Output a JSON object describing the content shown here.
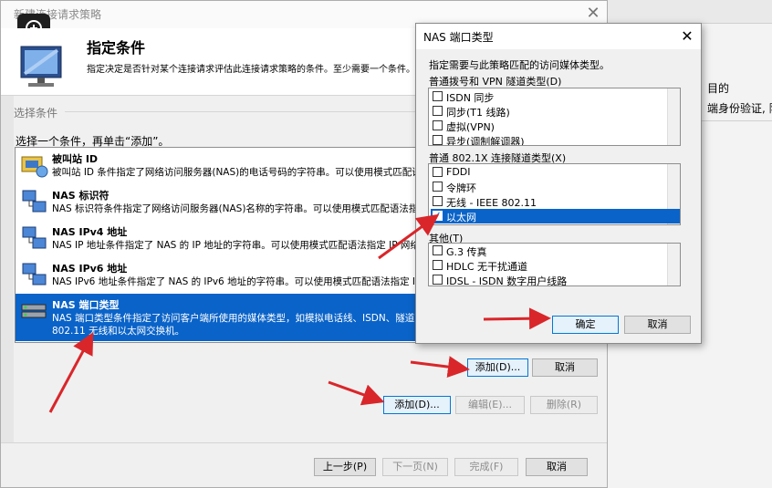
{
  "background_window": {
    "text1": "目的",
    "text2": "端身份验证, 限"
  },
  "main_dialog": {
    "title": "新建连接请求策略",
    "close_glyph": "✕",
    "heading": "指定条件",
    "description": "指定决定是否针对某个连接请求评估此连接请求策略的条件。至少需要一个条件。",
    "section_label": "选择条件",
    "instruction": "选择一个条件，再单击“添加”。",
    "conditions": [
      {
        "title": "被叫站 ID",
        "desc": "被叫站 ID 条件指定了网络访问服务器(NAS)的电话号码的字符串。可以使用模式匹配语法指定区号。"
      },
      {
        "title": "NAS 标识符",
        "desc": "NAS 标识符条件指定了网络访问服务器(NAS)名称的字符串。可以使用模式匹配语法指定 NAS 名称。"
      },
      {
        "title": "NAS IPv4 地址",
        "desc": "NAS IP 地址条件指定了 NAS 的 IP 地址的字符串。可以使用模式匹配语法指定 IP 网络。"
      },
      {
        "title": "NAS IPv6 地址",
        "desc": "NAS IPv6 地址条件指定了 NAS 的 IPv6 地址的字符串。可以使用模式匹配语法指定 IPv6 网络。"
      },
      {
        "title": "NAS 端口类型",
        "desc": "NAS 端口类型条件指定了访问客户端所使用的媒体类型，如模拟电话线、ISDN、隧道或虚拟专用网络、IEEE",
        "desc2": "802.11 无线和以太网交换机。"
      }
    ],
    "buttons": {
      "add_top": "添加(D)...",
      "cancel_top": "取消",
      "add": "添加(D)...",
      "edit": "编辑(E)...",
      "remove": "删除(R)",
      "prev": "上一步(P)",
      "next": "下一页(N)",
      "finish": "完成(F)",
      "cancel": "取消"
    }
  },
  "nas_dialog": {
    "title": "NAS 端口类型",
    "close_glyph": "✕",
    "prompt": "指定需要与此策略匹配的访问媒体类型。",
    "groups": [
      {
        "label": "普通拨号和 VPN 隧道类型(D)",
        "items": [
          {
            "label": "ISDN 同步",
            "checked": false
          },
          {
            "label": "同步(T1 线路)",
            "checked": false
          },
          {
            "label": "虚拟(VPN)",
            "checked": false
          },
          {
            "label": "异步(调制解调器)",
            "checked": false
          }
        ]
      },
      {
        "label": "普通 802.1X 连接隧道类型(X)",
        "items": [
          {
            "label": "FDDI",
            "checked": false
          },
          {
            "label": "令牌环",
            "checked": false
          },
          {
            "label": "无线 - IEEE 802.11",
            "checked": false
          },
          {
            "label": "以太网",
            "checked": true
          }
        ]
      },
      {
        "label": "其他(T)",
        "items": [
          {
            "label": "G.3 传真",
            "checked": false
          },
          {
            "label": "HDLC 无干扰通道",
            "checked": false
          },
          {
            "label": "IDSL - ISDN 数字用户线路",
            "checked": false
          }
        ]
      }
    ],
    "ok": "确定",
    "cancel": "取消"
  },
  "colors": {
    "selection": "#0a63c8",
    "arrow": "#d9262a"
  }
}
